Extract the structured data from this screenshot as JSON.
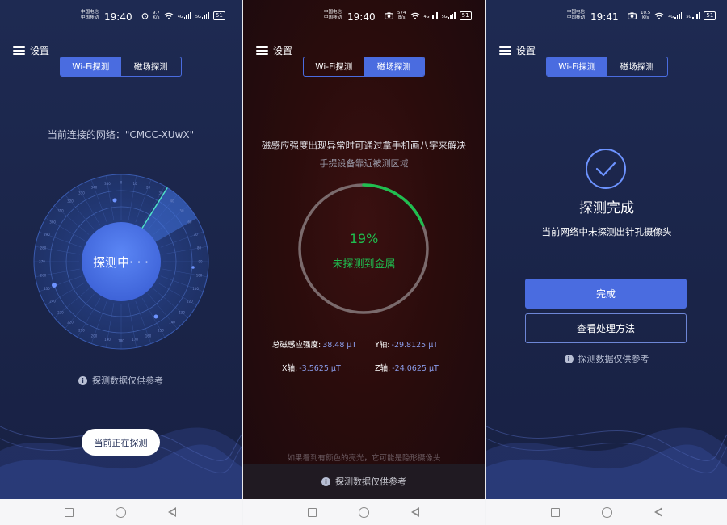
{
  "screens": [
    {
      "status": {
        "carrier1": "中国电信",
        "carrier2": "中国移动",
        "time": "19:40",
        "speed_value": "9.7",
        "speed_unit": "K/s",
        "network_a": "4G",
        "network_b": "5G",
        "battery": "51"
      },
      "menu_label": "设置",
      "tabs": [
        {
          "label": "Wi-Fi探测",
          "active": true
        },
        {
          "label": "磁场探测",
          "active": false
        }
      ],
      "network_text": "当前连接的网络：\"CMCC-XUwX\"",
      "radar_label": "探测中· · ·",
      "radar_ticks": [
        "0",
        "10",
        "20",
        "30",
        "40",
        "50",
        "60",
        "70",
        "80",
        "90",
        "100",
        "110",
        "120",
        "130",
        "140",
        "150",
        "160",
        "170",
        "180",
        "190",
        "200",
        "210",
        "220",
        "230",
        "240",
        "250",
        "260",
        "270",
        "280",
        "290",
        "300",
        "310",
        "320",
        "330",
        "340",
        "350"
      ],
      "note": "探测数据仅供参考",
      "status_pill": "当前正在探测"
    },
    {
      "status": {
        "carrier1": "中国电信",
        "carrier2": "中国移动",
        "time": "19:40",
        "speed_value": "574",
        "speed_unit": "B/s",
        "network_a": "4G",
        "network_b": "5G",
        "battery": "51"
      },
      "menu_label": "设置",
      "tabs": [
        {
          "label": "Wi-Fi探测",
          "active": false
        },
        {
          "label": "磁场探测",
          "active": true
        }
      ],
      "hint_line1": "磁感应强度出现异常时可通过拿手机画八字来解决",
      "hint_line2": "手提设备靠近被测区域",
      "progress_percent": 19,
      "progress_label": "19%",
      "result_text": "未探测到金属",
      "readings": [
        {
          "label": "总磁感应强度:",
          "value": "38.48 µT"
        },
        {
          "label": "Y轴:",
          "value": "-29.8125 µT"
        },
        {
          "label": "X轴:",
          "value": "-3.5625 µT"
        },
        {
          "label": "Z轴:",
          "value": "-24.0625 µT"
        }
      ],
      "footer_hint": "如果看到有颜色的亮光，它可能是隐形摄像头",
      "note": "探测数据仅供参考"
    },
    {
      "status": {
        "carrier1": "中国电信",
        "carrier2": "中国移动",
        "time": "19:41",
        "speed_value": "10.5",
        "speed_unit": "K/s",
        "network_a": "4G",
        "network_b": "5G",
        "battery": "51"
      },
      "menu_label": "设置",
      "tabs": [
        {
          "label": "Wi-Fi探测",
          "active": true
        },
        {
          "label": "磁场探测",
          "active": false
        }
      ],
      "done_title": "探测完成",
      "done_subtitle": "当前网络中未探测出针孔摄像头",
      "primary_button": "完成",
      "secondary_button": "查看处理方法",
      "note": "探测数据仅供参考"
    }
  ],
  "colors": {
    "accent": "#4a6ce0",
    "progress_green": "#1fbf4f",
    "dark_bg": "#1e2a52"
  }
}
